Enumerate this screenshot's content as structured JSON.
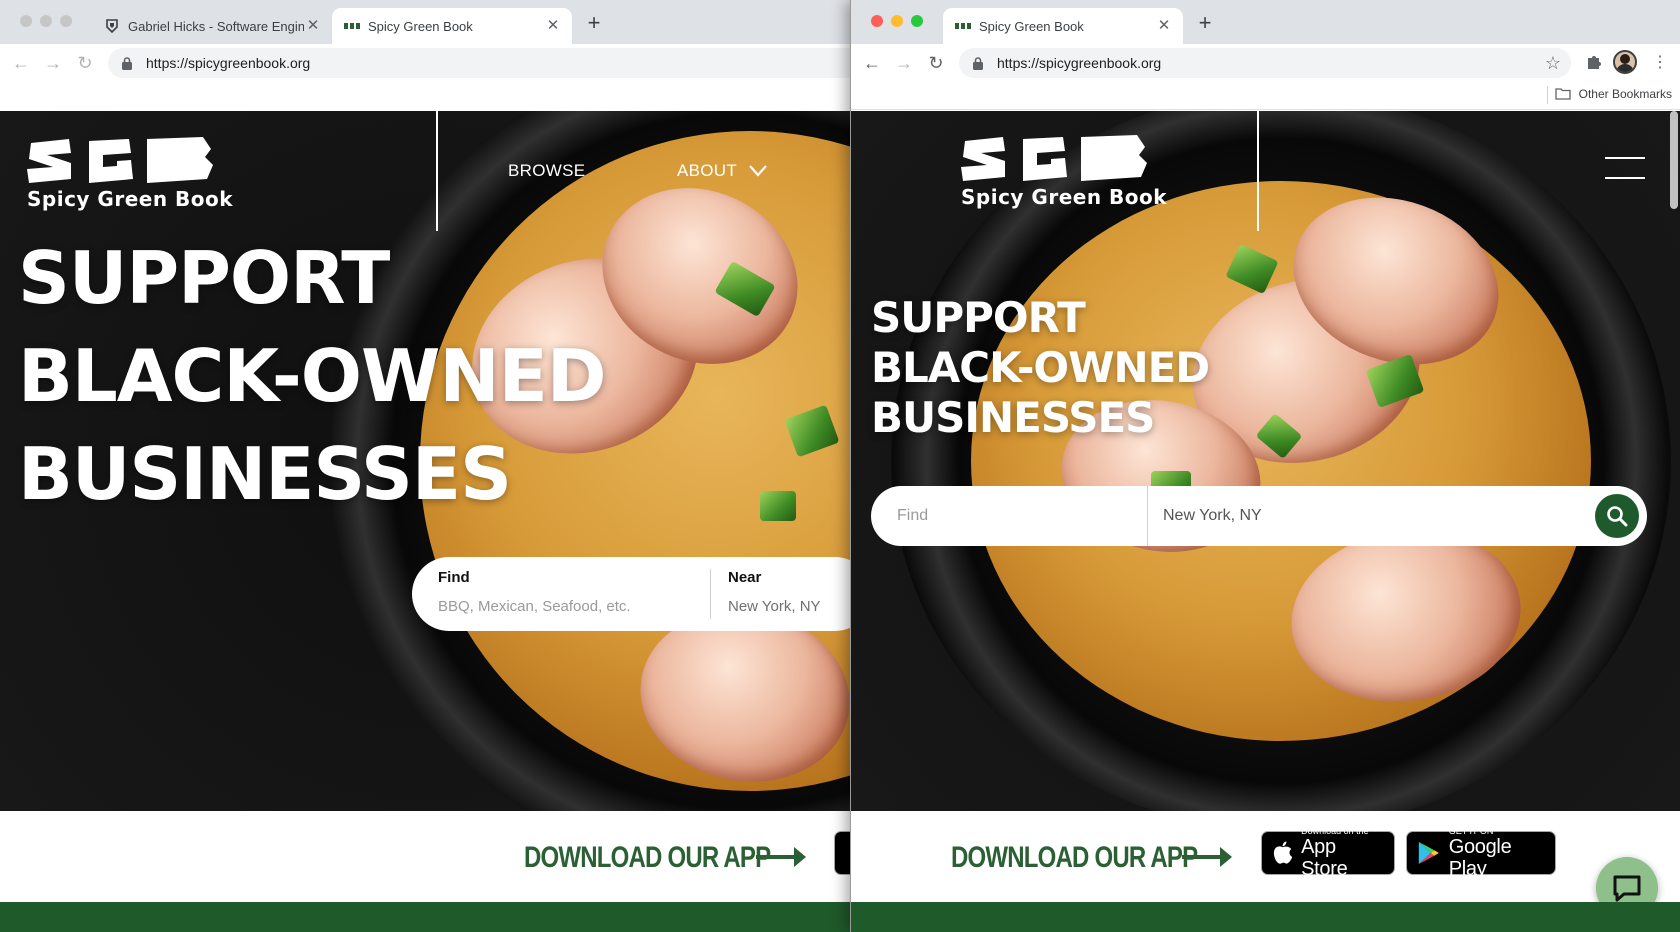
{
  "left_window": {
    "tabs": [
      {
        "title": "Gabriel Hicks - Software Engin"
      },
      {
        "title": "Spicy Green Book"
      }
    ],
    "url": "https://spicygreenbook.org"
  },
  "right_window": {
    "tabs": [
      {
        "title": "Spicy Green Book"
      }
    ],
    "url": "https://spicygreenbook.org",
    "bookmarks_label": "Other Bookmarks"
  },
  "site": {
    "logo_sub": "Spicy Green Book",
    "nav": {
      "browse": "BROWSE",
      "about": "ABOUT"
    },
    "headline": [
      "SUPPORT",
      "BLACK-OWNED",
      "BUSINESSES"
    ],
    "search": {
      "find_label": "Find",
      "find_placeholder": "BBQ, Mexican, Seafood, etc.",
      "near_label": "Near",
      "near_value": "New York, NY",
      "mobile_find_placeholder": "Find",
      "mobile_near_value": "New York, NY"
    },
    "download_text": "DOWNLOAD OUR APP",
    "app_store": {
      "small": "Download on the",
      "big": "App Store"
    },
    "google_play": {
      "small": "GET IT ON",
      "big": "Google Play"
    }
  },
  "colors": {
    "brand_green": "#2a6033",
    "footer_green": "#1f5a2a",
    "search_button": "#1e5a2b"
  },
  "icons": [
    "apple-icon",
    "google-play-icon",
    "search-icon",
    "hamburger-menu-icon",
    "chat-icon",
    "chevron-down-icon",
    "star-icon",
    "puzzle-icon",
    "kebab-menu-icon",
    "folder-icon",
    "lock-icon"
  ]
}
